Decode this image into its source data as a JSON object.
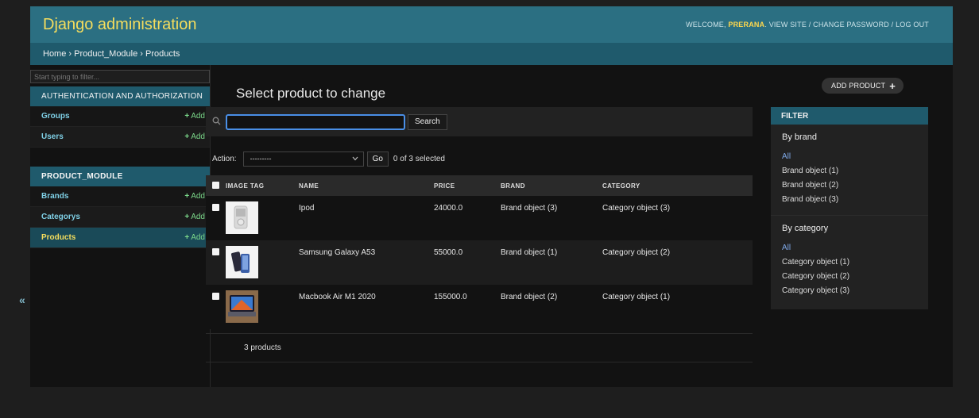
{
  "header": {
    "branding": "Django administration",
    "welcome": "WELCOME,",
    "username": "PRERANA",
    "view_site": "VIEW SITE",
    "change_password": "CHANGE PASSWORD",
    "log_out": "LOG OUT"
  },
  "breadcrumbs": {
    "home": "Home",
    "app": "Product_Module",
    "model": "Products",
    "sep": " › "
  },
  "sidebar": {
    "filter_placeholder": "Start typing to filter...",
    "apps": [
      {
        "name": "AUTHENTICATION AND AUTHORIZATION",
        "models": [
          {
            "label": "Groups",
            "add": "Add"
          },
          {
            "label": "Users",
            "add": "Add"
          }
        ]
      },
      {
        "name": "PRODUCT_MODULE",
        "models": [
          {
            "label": "Brands",
            "add": "Add"
          },
          {
            "label": "Categorys",
            "add": "Add"
          },
          {
            "label": "Products",
            "add": "Add"
          }
        ]
      }
    ],
    "collapse": "«"
  },
  "main": {
    "title": "Select product to change",
    "add_button": "ADD PRODUCT",
    "search": {
      "value": "",
      "button": "Search"
    },
    "actions": {
      "label": "Action:",
      "selected_option": "---------",
      "go": "Go",
      "counter": "0 of 3 selected"
    },
    "table": {
      "columns": [
        "IMAGE TAG",
        "NAME",
        "PRICE",
        "BRAND",
        "CATEGORY"
      ],
      "rows": [
        {
          "name": "Ipod",
          "price": "24000.0",
          "brand": "Brand object (3)",
          "category": "Category object (3)"
        },
        {
          "name": "Samsung Galaxy A53",
          "price": "55000.0",
          "brand": "Brand object (1)",
          "category": "Category object (2)"
        },
        {
          "name": "Macbook Air M1 2020",
          "price": "155000.0",
          "brand": "Brand object (2)",
          "category": "Category object (1)"
        }
      ]
    },
    "paginator": "3 products"
  },
  "filter": {
    "title": "FILTER",
    "groups": [
      {
        "title": "By brand",
        "options": [
          "All",
          "Brand object (1)",
          "Brand object (2)",
          "Brand object (3)"
        ]
      },
      {
        "title": "By category",
        "options": [
          "All",
          "Category object (1)",
          "Category object (2)",
          "Category object (3)"
        ]
      }
    ]
  },
  "colors": {
    "header_bg": "#2b6f82",
    "breadcrumbs_bg": "#1f5a6c",
    "branding": "#f5dd5d",
    "link": "#7fd0e6",
    "add_green": "#7bd88a",
    "page_bg": "#121212"
  },
  "icons": {
    "search": "search-icon",
    "add": "plus-icon",
    "collapse": "double-chevron-left-icon"
  }
}
